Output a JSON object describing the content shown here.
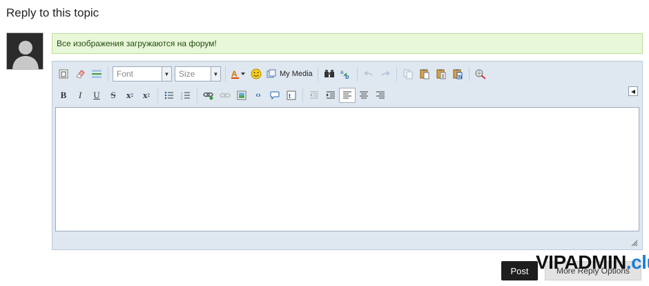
{
  "heading": "Reply to this topic",
  "notice": "Все изображения загружаются на форум!",
  "toolbar": {
    "font_placeholder": "Font",
    "size_placeholder": "Size",
    "my_media_label": "My Media"
  },
  "buttons": {
    "post": "Post",
    "more_reply_options": "More Reply Options"
  },
  "watermark": {
    "main": "VIPADMIN",
    "suffix": ".club"
  },
  "colors": {
    "notice_bg": "#e8f7d8",
    "editor_bg": "#dfe8f1",
    "post_bg": "#1e1e1e",
    "watermark_accent": "#1a7fd6"
  }
}
